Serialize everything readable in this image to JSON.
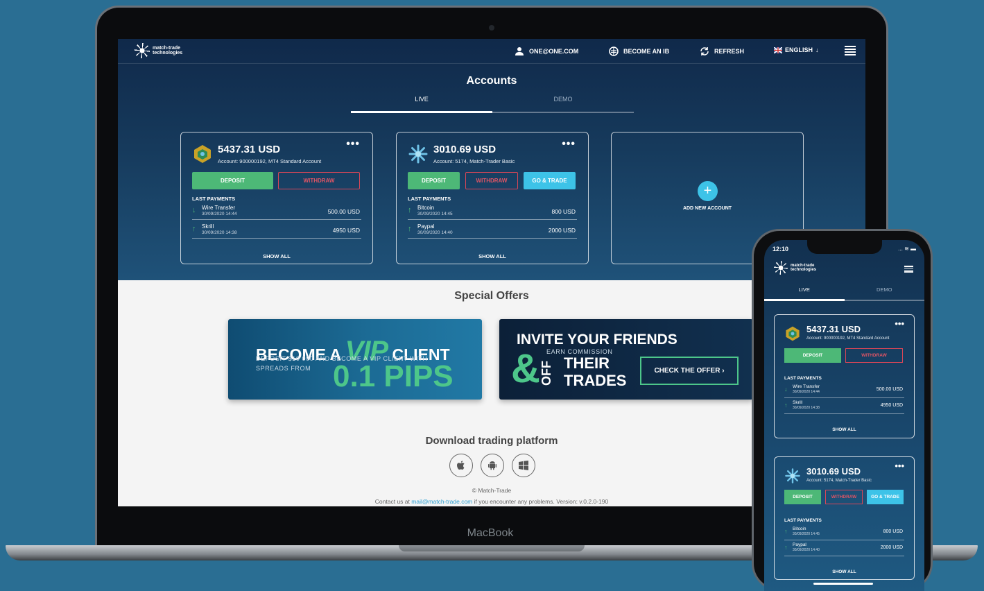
{
  "laptop": {
    "brand_label": "MacBook"
  },
  "nav": {
    "logo_text": "match-trade technologies",
    "user_email": "ONE@ONE.COM",
    "become_ib": "BECOME AN IB",
    "refresh": "REFRESH",
    "language": "ENGLISH"
  },
  "accounts": {
    "title": "Accounts",
    "tabs": [
      {
        "label": "LIVE",
        "active": true
      },
      {
        "label": "DEMO",
        "active": false
      }
    ],
    "cards": [
      {
        "amount": "5437.31 USD",
        "info": "Account: 900000192, MT4 Standard Account",
        "deposit": "DEPOSIT",
        "withdraw": "WITHDRAW",
        "last_payments_label": "LAST PAYMENTS",
        "payments": [
          {
            "name": "Wire Transfer",
            "date": "30/09/2020 14:44",
            "amount": "500.00 USD",
            "direction": "down"
          },
          {
            "name": "Skrill",
            "date": "30/09/2020 14:38",
            "amount": "4950 USD",
            "direction": "up"
          }
        ],
        "show_all": "SHOW ALL"
      },
      {
        "amount": "3010.69 USD",
        "info": "Account: 5174, Match-Trader Basic",
        "deposit": "DEPOSIT",
        "withdraw": "WITHDRAW",
        "trade": "GO & TRADE",
        "last_payments_label": "LAST PAYMENTS",
        "payments": [
          {
            "name": "Bitcoin",
            "date": "30/09/2020 14:45",
            "amount": "800 USD",
            "direction": "up"
          },
          {
            "name": "Paypal",
            "date": "30/09/2020 14:40",
            "amount": "2000 USD",
            "direction": "up"
          }
        ],
        "show_all": "SHOW ALL"
      }
    ],
    "add_account": "ADD NEW ACCOUNT"
  },
  "offers": {
    "title": "Special Offers",
    "vip": {
      "become": "BECOME A",
      "vip": "VIP",
      "client": "CLIENT",
      "sub1": "DEPOSIT $10 000 AND BECOME A VIP CLIENT WITH",
      "sub2": "SPREADS FROM",
      "pips": "0.1 PIPS"
    },
    "invite": {
      "line1": "INVITE YOUR FRIENDS",
      "amp": "&",
      "off": "OFF",
      "earn": "EARN COMMISSION",
      "their": "THEIR",
      "trades": "TRADES",
      "cta": "CHECK THE OFFER ›"
    }
  },
  "download": {
    "title": "Download trading platform",
    "platforms": [
      "apple-icon",
      "android-icon",
      "windows-icon"
    ]
  },
  "footer": {
    "copyright": "© Match-Trade",
    "contact_prefix": "Contact us at",
    "email": "mail@match-trade.com",
    "contact_suffix": "if you encounter any problems. Version: v.0.2.0-190"
  },
  "phone": {
    "time": "12:10",
    "status": "... ≋ ▬",
    "logo_text": "match-trade technologies",
    "tabs": [
      {
        "label": "LIVE",
        "active": true
      },
      {
        "label": "DEMO",
        "active": false
      }
    ]
  },
  "colors": {
    "deposit": "#4db877",
    "withdraw": "#d94657",
    "trade": "#3dc3e8",
    "background": "#2a6e93"
  }
}
